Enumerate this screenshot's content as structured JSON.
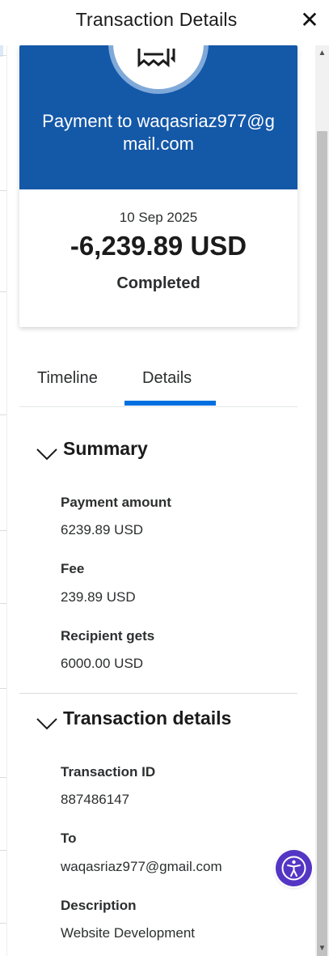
{
  "header": {
    "title": "Transaction Details",
    "close_label": "✕"
  },
  "card": {
    "payment_to": "Payment to waqasriaz977@gmail.com",
    "date": "10 Sep 2025",
    "amount": "-6,239.89 USD",
    "status": "Completed",
    "icon": "receipt-icon"
  },
  "tabs": [
    {
      "label": "Timeline",
      "active": false
    },
    {
      "label": "Details",
      "active": true
    }
  ],
  "summary": {
    "heading": "Summary",
    "fields": [
      {
        "label": "Payment amount",
        "value": "6239.89 USD"
      },
      {
        "label": "Fee",
        "value": "239.89 USD"
      },
      {
        "label": "Recipient gets",
        "value": "6000.00 USD"
      }
    ]
  },
  "transaction_details": {
    "heading": "Transaction details",
    "fields": [
      {
        "label": "Transaction ID",
        "value": "887486147"
      },
      {
        "label": "To",
        "value": "waqasriaz977@gmail.com"
      },
      {
        "label": "Description",
        "value": "Website Development"
      }
    ]
  },
  "colors": {
    "brand_blue": "#1458a8",
    "tab_accent": "#0070e0",
    "accessibility_purple": "#5436c4"
  }
}
